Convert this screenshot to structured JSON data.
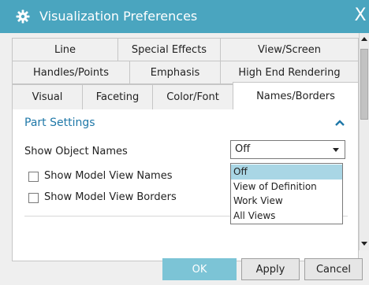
{
  "window": {
    "title": "Visualization Preferences",
    "close_label": "X",
    "title_icon": "gear-icon"
  },
  "tabs": {
    "row1": [
      "Line",
      "Special Effects",
      "View/Screen"
    ],
    "row2": [
      "Handles/Points",
      "Emphasis",
      "High End Rendering"
    ],
    "row3": [
      "Visual",
      "Faceting",
      "Color/Font",
      "Names/Borders"
    ],
    "active": "Names/Borders"
  },
  "section": {
    "title": "Part Settings",
    "collapse_icon": "chevron-up-icon"
  },
  "settings": {
    "show_object_names_label": "Show Object Names",
    "show_object_names_value": "Off",
    "show_model_view_names": {
      "label": "Show Model View Names",
      "checked": false
    },
    "show_model_view_borders": {
      "label": "Show Model View Borders",
      "checked": false
    }
  },
  "dropdown": {
    "options": [
      "Off",
      "View of Definition",
      "Work View",
      "All Views"
    ],
    "selected": "Off"
  },
  "buttons": {
    "ok": "OK",
    "apply": "Apply",
    "cancel": "Cancel"
  },
  "colors": {
    "title_bar": "#4aa5bf",
    "accent_text": "#1f78a8",
    "selected_option": "#a9d6e5",
    "ok_button": "#7cc4d6"
  }
}
